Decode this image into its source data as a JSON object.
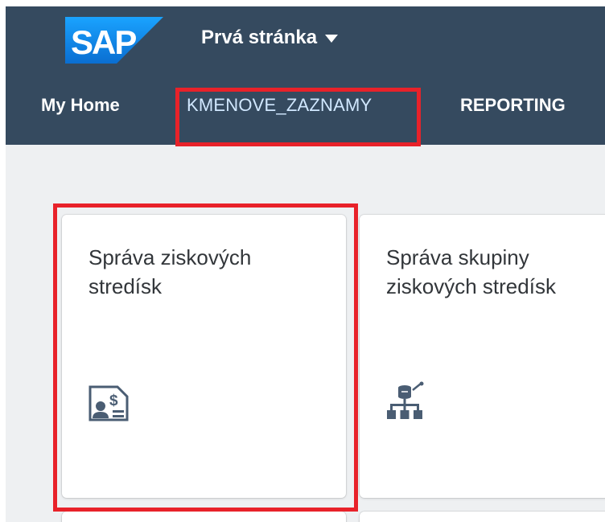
{
  "shell": {
    "logo_text": "SAP",
    "app_title": "Prvá stránka",
    "logo_color": "#0a6ed1",
    "bar_color": "#354a5f"
  },
  "tabs": [
    {
      "label": "My Home"
    },
    {
      "label": "KMENOVE_ZAZNAMY",
      "selected": true
    },
    {
      "label": "REPORTING"
    }
  ],
  "tiles": [
    {
      "title": "Správa ziskových stredísk",
      "icon": "profit-center-id-card-icon"
    },
    {
      "title": "Správa skupiny ziskových stredísk",
      "icon": "hierarchy-database-icon"
    }
  ],
  "highlight_color": "#e8222a"
}
